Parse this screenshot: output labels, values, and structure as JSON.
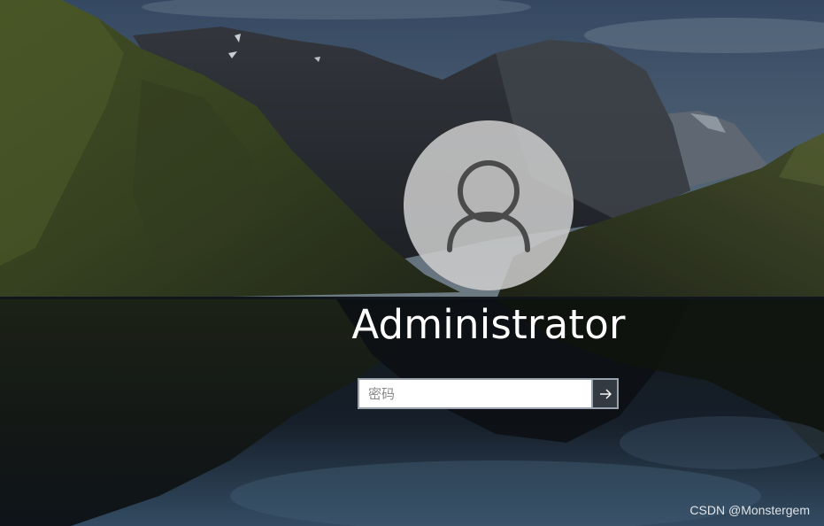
{
  "login": {
    "username": "Administrator",
    "password_placeholder": "密码",
    "password_value": ""
  },
  "icons": {
    "avatar": "user-silhouette-icon",
    "submit": "arrow-right-icon"
  },
  "colors": {
    "avatar_bg": "#cdcdcd",
    "avatar_stroke": "#4a4a4a",
    "input_border": "#9aa3ad",
    "submit_bg": "#3c424a",
    "text": "#ffffff"
  },
  "watermark": {
    "text": "CSDN @Monstergem"
  }
}
